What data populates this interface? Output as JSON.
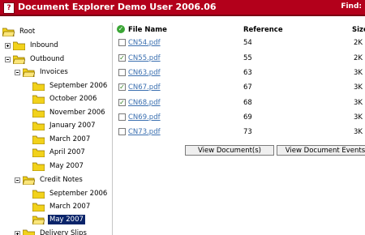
{
  "header": {
    "help_label": "?",
    "title": "Document Explorer Demo User 2006.06",
    "find_label": "Find:"
  },
  "tree": {
    "items": [
      {
        "label": "Root"
      },
      {
        "label": "Inbound"
      },
      {
        "label": "Outbound"
      },
      {
        "label": "Invoices"
      },
      {
        "label": "September 2006"
      },
      {
        "label": "October 2006"
      },
      {
        "label": "November 2006"
      },
      {
        "label": "January 2007"
      },
      {
        "label": "March 2007"
      },
      {
        "label": "April 2007"
      },
      {
        "label": "May 2007"
      },
      {
        "label": "Credit Notes"
      },
      {
        "label": "September 2006"
      },
      {
        "label": "March 2007"
      },
      {
        "label": "May 2007",
        "selected": true
      },
      {
        "label": "Delivery Slips"
      }
    ]
  },
  "table": {
    "columns": [
      "File Name",
      "Reference",
      "Size"
    ],
    "rows": [
      {
        "file": "CN54.pdf",
        "reference": "54",
        "size": "2K",
        "checked": false
      },
      {
        "file": "CN55.pdf",
        "reference": "55",
        "size": "2K",
        "checked": true
      },
      {
        "file": "CN63.pdf",
        "reference": "63",
        "size": "3K",
        "checked": false
      },
      {
        "file": "CN67.pdf",
        "reference": "67",
        "size": "3K",
        "checked": true
      },
      {
        "file": "CN68.pdf",
        "reference": "68",
        "size": "3K",
        "checked": true
      },
      {
        "file": "CN69.pdf",
        "reference": "69",
        "size": "3K",
        "checked": false
      },
      {
        "file": "CN73.pdf",
        "reference": "73",
        "size": "3K",
        "checked": false
      }
    ]
  },
  "actions": {
    "view_documents": "View Document(s)",
    "view_document_events": "View Document Events"
  },
  "colors": {
    "titlebar": "#b3001b",
    "link": "#3a6fb0",
    "selection": "#0a246a",
    "folder": "#f2d21b"
  }
}
